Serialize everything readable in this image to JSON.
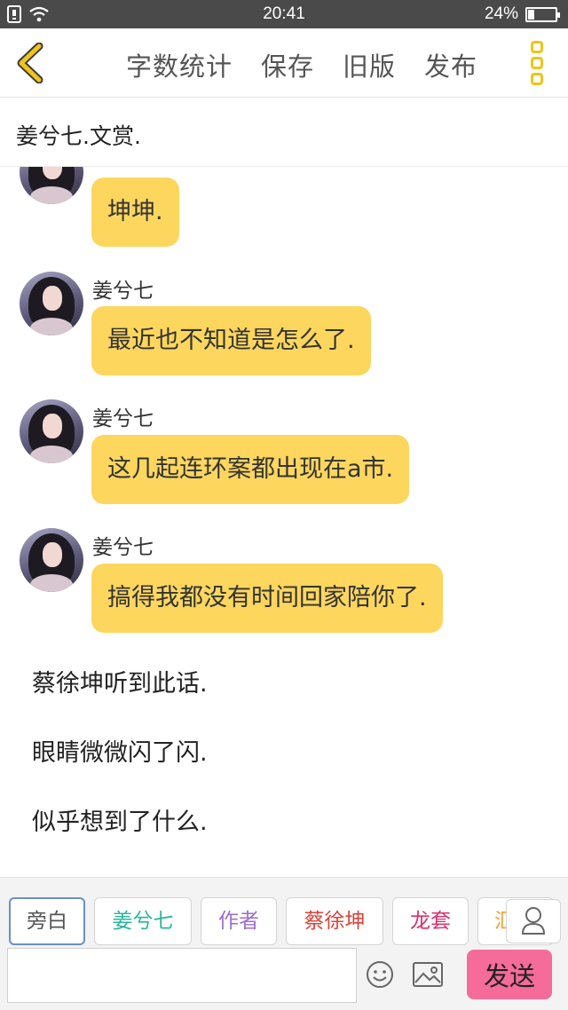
{
  "status_bar": {
    "time": "20:41",
    "battery_percent": "24%",
    "battery_level": 0.24
  },
  "header": {
    "back_icon": "chevron-left-icon",
    "actions": [
      "字数统计",
      "保存",
      "旧版",
      "发布"
    ],
    "more_icon": "more-vertical-icon",
    "accent_color": "#f0c419"
  },
  "title": "姜兮七.文赏.",
  "messages": [
    {
      "sender": "",
      "text": "坤坤."
    },
    {
      "sender": "姜兮七",
      "text": "最近也不知道是怎么了."
    },
    {
      "sender": "姜兮七",
      "text": "这几起连环案都出现在a市."
    },
    {
      "sender": "姜兮七",
      "text": "搞得我都没有时间回家陪你了."
    }
  ],
  "narration": [
    "蔡徐坤听到此话.",
    "眼睛微微闪了闪.",
    "似乎想到了什么."
  ],
  "roles": [
    {
      "label": "旁白",
      "color": "#555555",
      "active": true
    },
    {
      "label": "姜兮七",
      "color": "#2bb59a",
      "active": false
    },
    {
      "label": "作者",
      "color": "#9b6fd0",
      "active": false
    },
    {
      "label": "蔡徐坤",
      "color": "#d9433a",
      "active": false
    },
    {
      "label": "龙套",
      "color": "#d8316e",
      "active": false
    },
    {
      "label": "汇",
      "color": "#f2a43a",
      "active": false
    }
  ],
  "input": {
    "value": "",
    "placeholder": ""
  },
  "send_label": "发送",
  "colors": {
    "bubble": "#fdd65e",
    "send_button": "#f56b9a",
    "status_bar": "#4a4a4a"
  }
}
